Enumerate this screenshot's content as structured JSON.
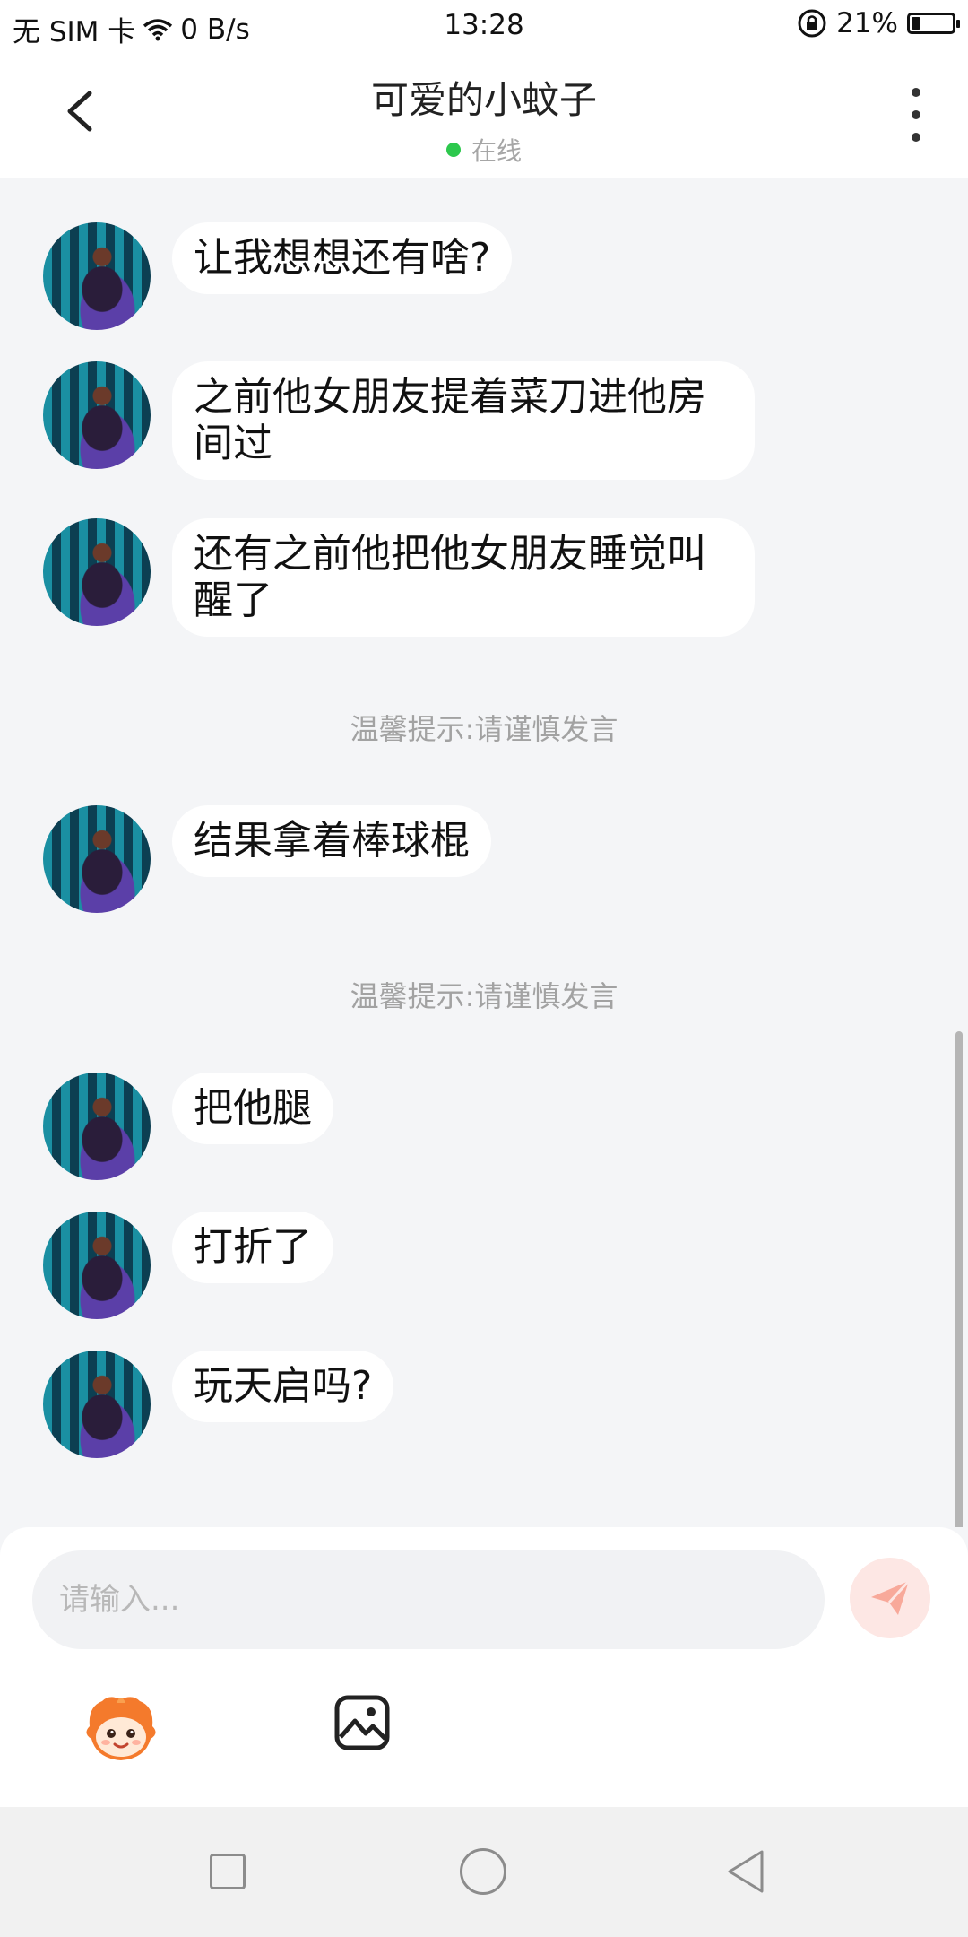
{
  "status_bar": {
    "carrier": "无 SIM 卡",
    "speed": "0 B/s",
    "time": "13:28",
    "battery": "21%",
    "battery_level": 0.21
  },
  "header": {
    "title": "可爱的小蚊子",
    "status": "在线",
    "back_icon": "chevron-left-icon",
    "more_icon": "vertical-dots-icon"
  },
  "messages": [
    {
      "text": "让我想想还有啥?"
    },
    {
      "text": "之前他女朋友提着菜刀进他房间过"
    },
    {
      "text": "还有之前他把他女朋友睡觉叫醒了"
    },
    {
      "tip": "温馨提示:请谨慎发言"
    },
    {
      "text": "结果拿着棒球棍"
    },
    {
      "tip": "温馨提示:请谨慎发言"
    },
    {
      "text": "把他腿"
    },
    {
      "text": "打折了"
    },
    {
      "text": "玩天启吗?"
    }
  ],
  "input": {
    "placeholder": "请输入..."
  },
  "toolbar": {
    "emoji_icon": "mascot-emoji-icon",
    "image_icon": "image-icon",
    "send_icon": "paper-plane-icon"
  },
  "colors": {
    "online": "#2dc84d",
    "send_bg": "#fde7e4",
    "send_icon": "#f8a99a",
    "chat_bg": "#f4f5f7"
  }
}
